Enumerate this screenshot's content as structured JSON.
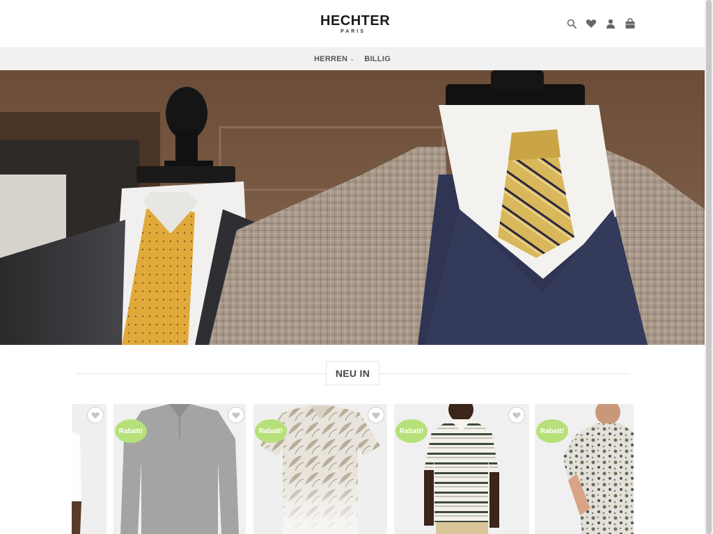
{
  "header": {
    "logo_main": "HECHTER",
    "logo_sub": "PARIS",
    "icons": [
      "search-icon",
      "heart-icon",
      "user-icon",
      "shopping-bag-icon"
    ]
  },
  "nav": {
    "items": [
      {
        "label": "HERREN",
        "has_dropdown": true
      },
      {
        "label": "BILLIG",
        "has_dropdown": false
      }
    ]
  },
  "section": {
    "title": "NEU IN"
  },
  "products": [
    {
      "badge": "",
      "image": "white shirt (cropped)"
    },
    {
      "badge": "Rabatt!",
      "image": "grey long-sleeve polo"
    },
    {
      "badge": "Rabatt!",
      "image": "leaf print polo"
    },
    {
      "badge": "Rabatt!",
      "image": "striped polo on model"
    },
    {
      "badge": "Rabatt!",
      "image": "floral shirt on model"
    }
  ],
  "colors": {
    "badge": "#b6e07a",
    "nav_bg": "#f1f1f1",
    "text_dark": "#1a1a1a"
  }
}
